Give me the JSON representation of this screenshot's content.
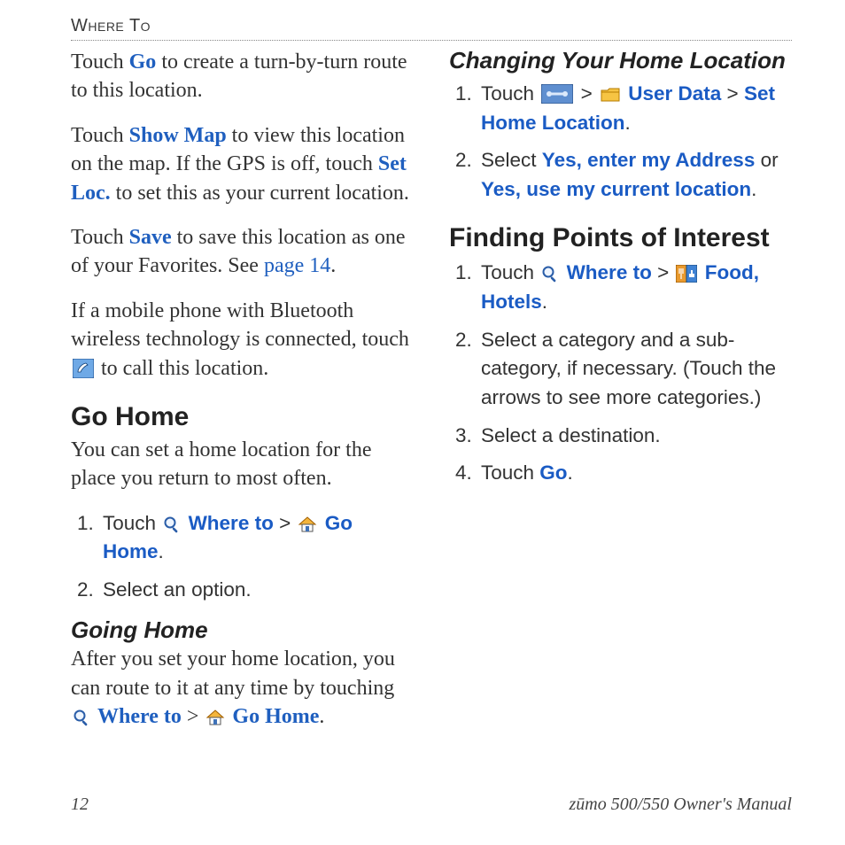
{
  "running_head": "Where To",
  "left": {
    "p1": {
      "pre": "Touch ",
      "go": "Go",
      "post": " to create a turn-by-turn route to this location."
    },
    "p2": {
      "a": "Touch ",
      "showmap": "Show Map",
      "b": " to view this location on the map. If the GPS is off, touch ",
      "setloc": "Set Loc.",
      "c": " to set this as your current location."
    },
    "p3": {
      "a": "Touch ",
      "save": "Save",
      "b": " to save this location as one of your Favorites. See ",
      "pagelink": "page 14",
      "c": "."
    },
    "p4": {
      "a": "If a mobile phone with Bluetooth wireless technology is connected, touch ",
      "b": " to call this location."
    },
    "h_go_home": "Go Home",
    "go_home_body": "You can set a home location for the place you return to most often.",
    "go_home_steps": {
      "s1_a": "Touch ",
      "s1_where": "Where to",
      "s1_gt": " > ",
      "s1_gohome": "Go Home",
      "s1_dot": ".",
      "s2": "Select an option."
    },
    "h_going_home": "Going Home",
    "going_home_body": {
      "a": "After you set your home location, you can route to it at any time by touching ",
      "where": "Where to",
      "gt": " > ",
      "gohome": "Go Home",
      "dot": "."
    }
  },
  "right": {
    "h_change_home": "Changing Your Home Location",
    "change_steps": {
      "s1_a": "Touch ",
      "s1_gt1": " > ",
      "s1_userdata": "User Data",
      "s1_gt2": " > ",
      "s1_sethome": "Set Home Location",
      "s1_dot": ".",
      "s2_a": "Select ",
      "s2_opt1": "Yes, enter my Address",
      "s2_or": " or ",
      "s2_opt2": "Yes, use my current location",
      "s2_dot": "."
    },
    "h_poi": "Finding Points of Interest",
    "poi_steps": {
      "s1_a": "Touch ",
      "s1_where": "Where to",
      "s1_gt": " > ",
      "s1_food": "Food, Hotels",
      "s1_dot": ".",
      "s2": "Select a category and a sub-category, if necessary. (Touch the arrows to see more categories.)",
      "s3": "Select a destination.",
      "s4_a": "Touch ",
      "s4_go": "Go",
      "s4_dot": "."
    }
  },
  "footer": {
    "page": "12",
    "doc": "zūmo 500/550 Owner's Manual"
  }
}
